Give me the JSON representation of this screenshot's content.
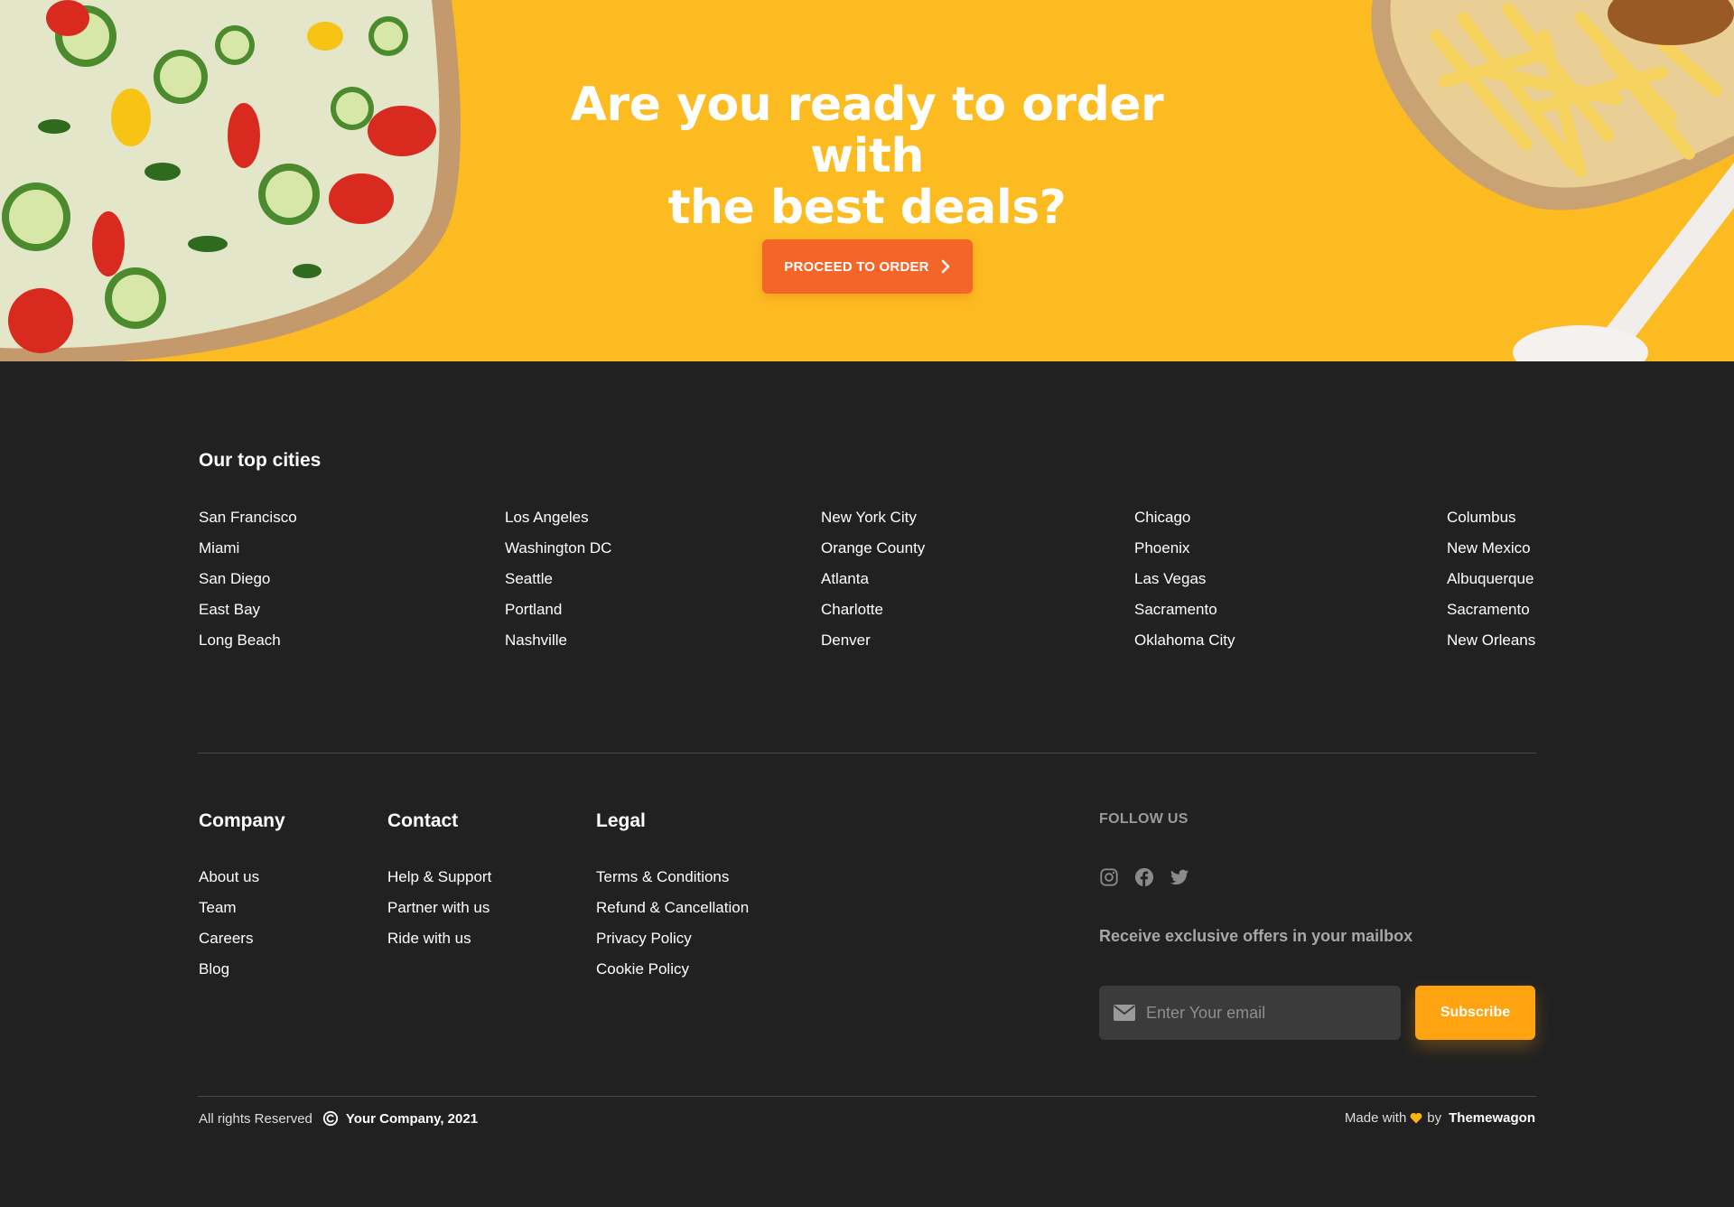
{
  "hero": {
    "title_line1": "Are you ready to order with",
    "title_line2": "the best deals?",
    "cta_label": "PROCEED TO ORDER",
    "cta_icon": "chevron-right-icon",
    "background_color": "#FDBB22",
    "cta_color": "#F4652A"
  },
  "cities": {
    "title": "Our top cities",
    "columns": [
      [
        "San Francisco",
        "Miami",
        "San Diego",
        "East Bay",
        "Long Beach"
      ],
      [
        "Los Angeles",
        "Washington DC",
        "Seattle",
        "Portland",
        "Nashville"
      ],
      [
        "New York City",
        "Orange County",
        "Atlanta",
        "Charlotte",
        "Denver"
      ],
      [
        "Chicago",
        "Phoenix",
        "Las Vegas",
        "Sacramento",
        "Oklahoma City"
      ],
      [
        "Columbus",
        "New Mexico",
        "Albuquerque",
        "Sacramento",
        "New Orleans"
      ]
    ]
  },
  "links": {
    "company": {
      "title": "Company",
      "items": [
        "About us",
        "Team",
        "Careers",
        "Blog"
      ]
    },
    "contact": {
      "title": "Contact",
      "items": [
        "Help & Support",
        "Partner with us",
        "Ride with us"
      ]
    },
    "legal": {
      "title": "Legal",
      "items": [
        "Terms & Conditions",
        "Refund & Cancellation",
        "Privacy Policy",
        "Cookie Policy"
      ]
    }
  },
  "follow": {
    "title": "FOLLOW US",
    "icons": [
      "instagram-icon",
      "facebook-icon",
      "twitter-icon"
    ]
  },
  "newsletter": {
    "title": "Receive exclusive offers in your mailbox",
    "placeholder": "Enter Your email",
    "button_label": "Subscribe",
    "button_color": "#FFA410"
  },
  "bottom": {
    "rights": "All rights Reserved",
    "company": "Your Company, 2021",
    "made_with": "Made with",
    "by": "by",
    "brand": "Themewagon",
    "heart_color": "#FFB30E"
  },
  "footer_background": "#212121"
}
